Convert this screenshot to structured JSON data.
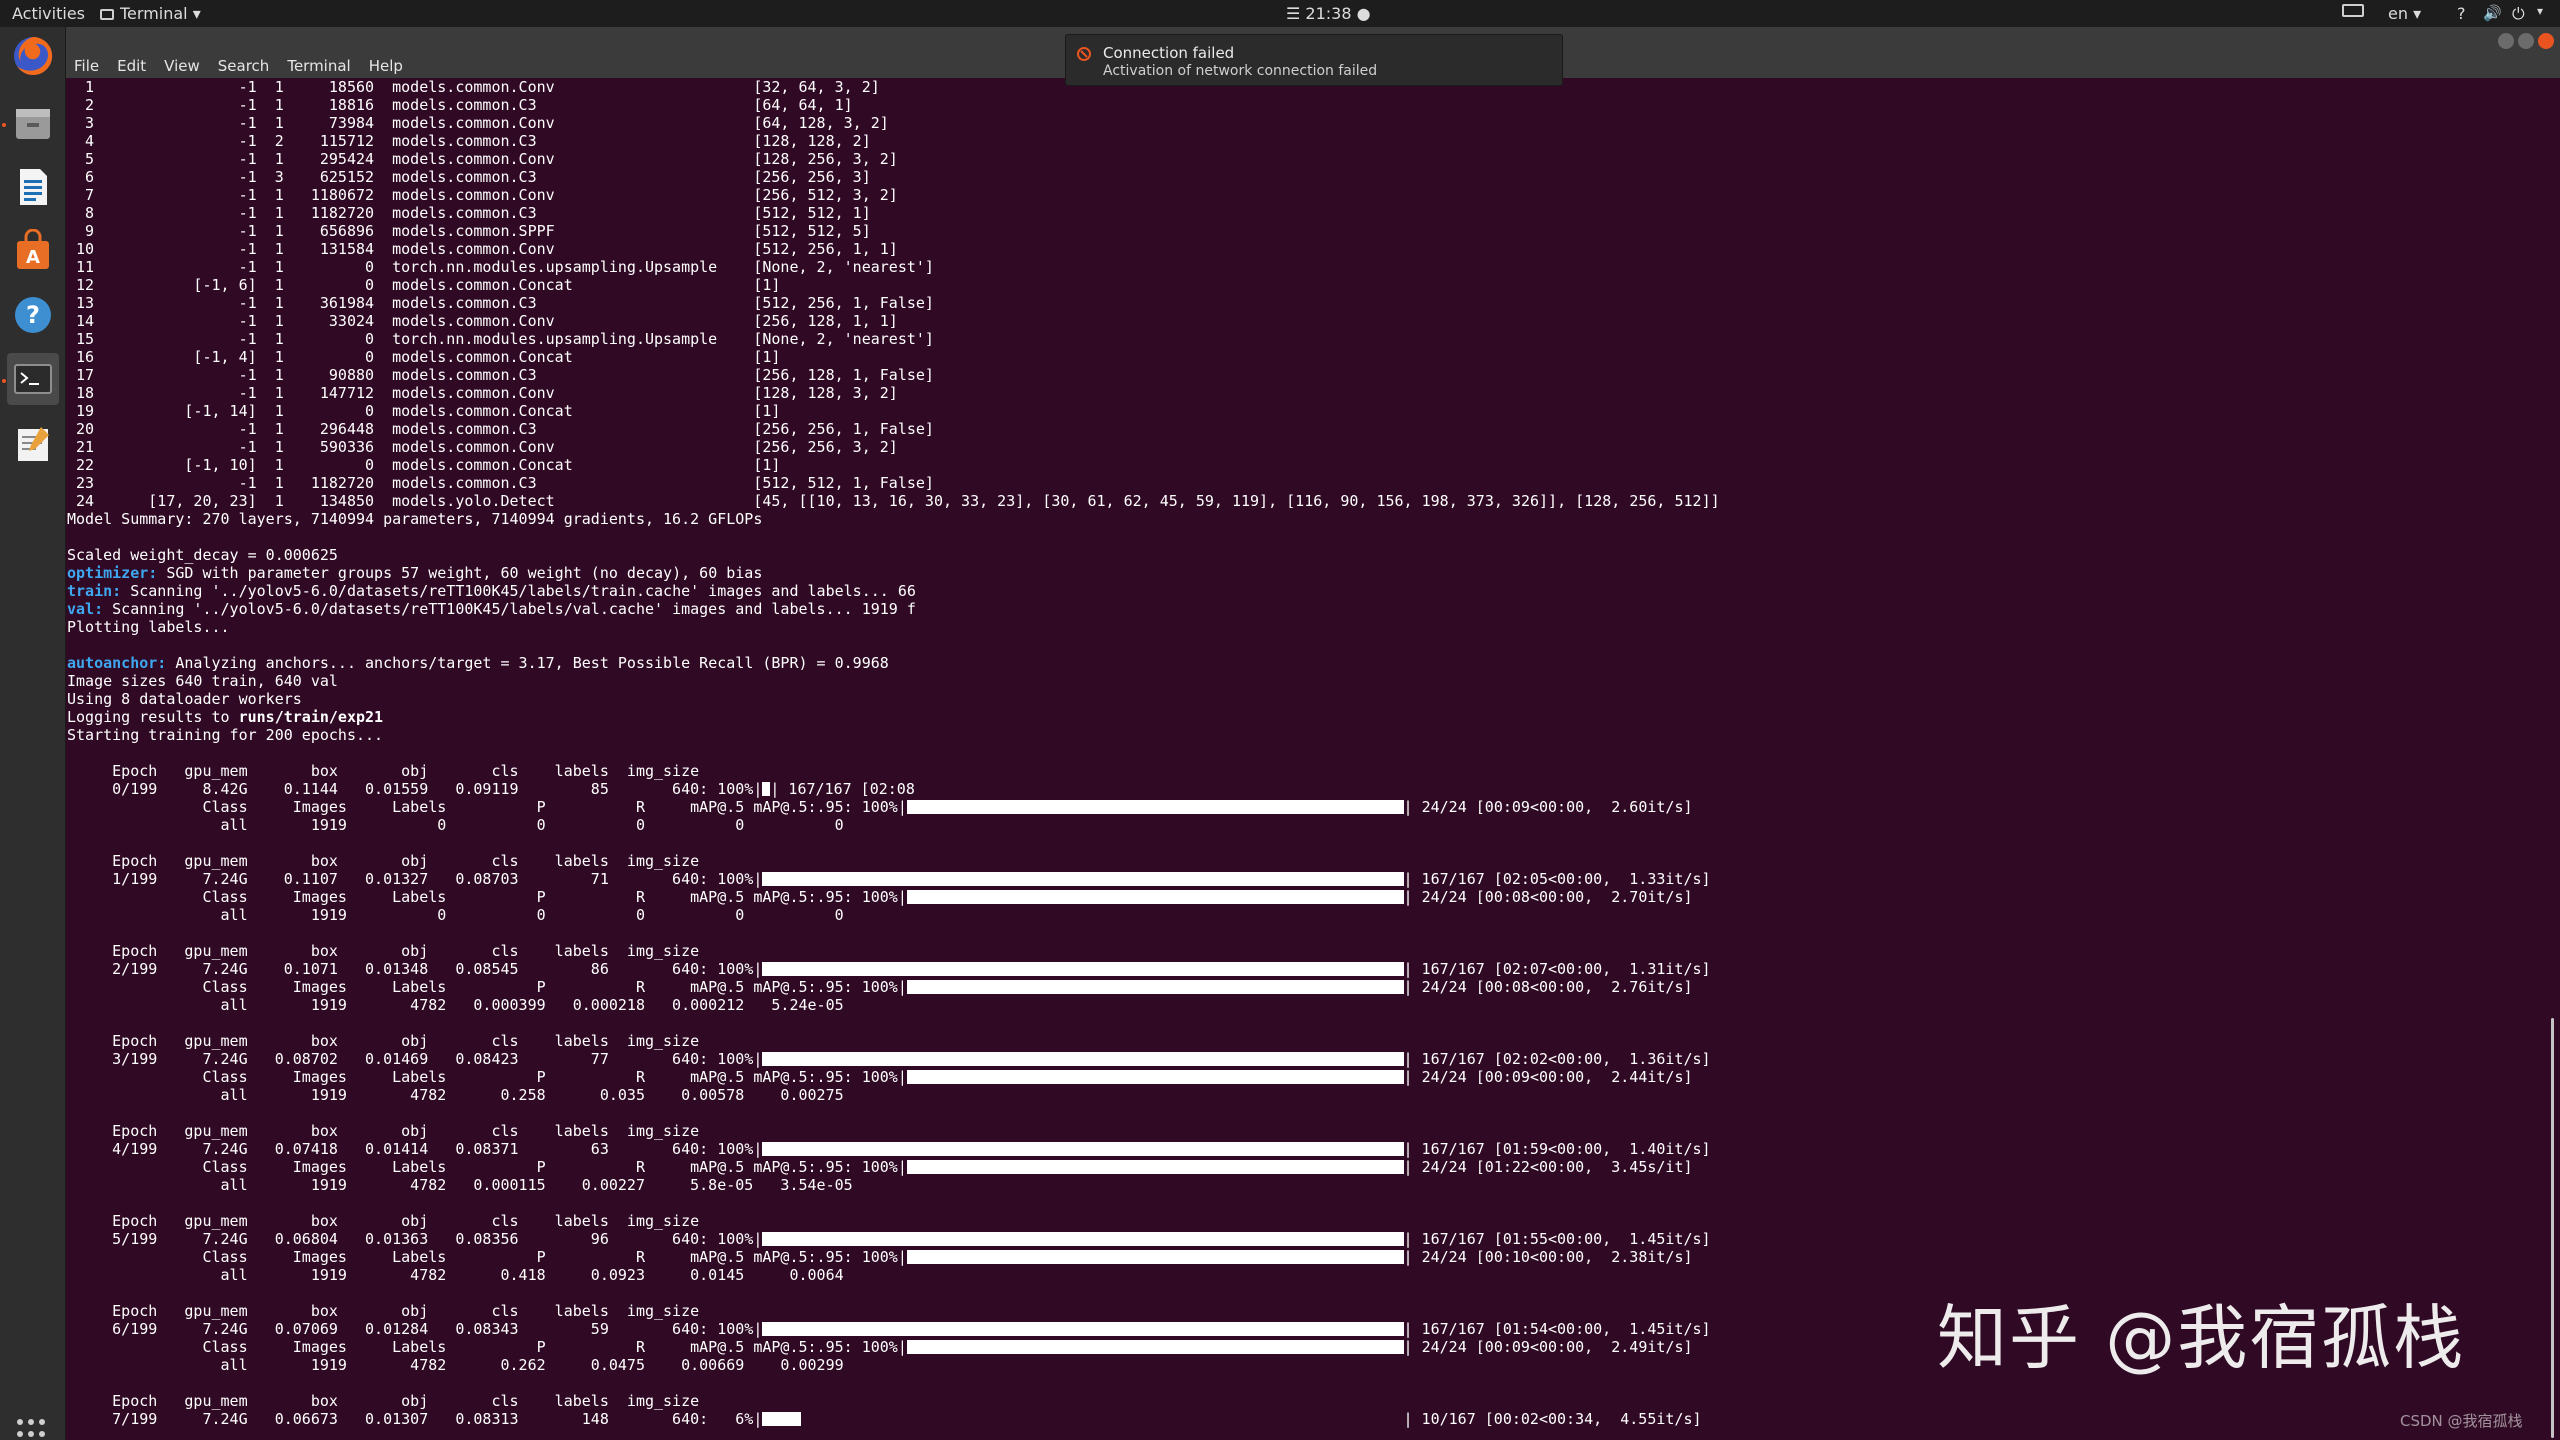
{
  "topbar": {
    "activities": "Activities",
    "app_name": "Terminal",
    "clock": "☰ 21:38 ●",
    "lang": "en ▾",
    "help": "?",
    "volume": "🔊",
    "power": "⏻",
    "caret": "▾"
  },
  "menu": [
    "File",
    "Edit",
    "View",
    "Search",
    "Terminal",
    "Help"
  ],
  "notification": {
    "title": "Connection failed",
    "body": "Activation of network connection failed"
  },
  "dock": [
    "firefox-icon",
    "files-icon",
    "libreoffice-writer-icon",
    "software-center-icon",
    "help-icon",
    "terminal-icon",
    "text-editor-icon"
  ],
  "terminal": {
    "layers": [
      "  1                -1  1     18560  models.common.Conv                      [32, 64, 3, 2]",
      "  2                -1  1     18816  models.common.C3                        [64, 64, 1]",
      "  3                -1  1     73984  models.common.Conv                      [64, 128, 3, 2]",
      "  4                -1  2    115712  models.common.C3                        [128, 128, 2]",
      "  5                -1  1    295424  models.common.Conv                      [128, 256, 3, 2]",
      "  6                -1  3    625152  models.common.C3                        [256, 256, 3]",
      "  7                -1  1   1180672  models.common.Conv                      [256, 512, 3, 2]",
      "  8                -1  1   1182720  models.common.C3                        [512, 512, 1]",
      "  9                -1  1    656896  models.common.SPPF                      [512, 512, 5]",
      " 10                -1  1    131584  models.common.Conv                      [512, 256, 1, 1]",
      " 11                -1  1         0  torch.nn.modules.upsampling.Upsample    [None, 2, 'nearest']",
      " 12           [-1, 6]  1         0  models.common.Concat                    [1]",
      " 13                -1  1    361984  models.common.C3                        [512, 256, 1, False]",
      " 14                -1  1     33024  models.common.Conv                      [256, 128, 1, 1]",
      " 15                -1  1         0  torch.nn.modules.upsampling.Upsample    [None, 2, 'nearest']",
      " 16           [-1, 4]  1         0  models.common.Concat                    [1]",
      " 17                -1  1     90880  models.common.C3                        [256, 128, 1, False]",
      " 18                -1  1    147712  models.common.Conv                      [128, 128, 3, 2]",
      " 19          [-1, 14]  1         0  models.common.Concat                    [1]",
      " 20                -1  1    296448  models.common.C3                        [256, 256, 1, False]",
      " 21                -1  1    590336  models.common.Conv                      [256, 256, 3, 2]",
      " 22          [-1, 10]  1         0  models.common.Concat                    [1]",
      " 23                -1  1   1182720  models.common.C3                        [512, 512, 1, False]",
      " 24      [17, 20, 23]  1    134850  models.yolo.Detect                      [45, [[10, 13, 16, 30, 33, 23], [30, 61, 62, 45, 59, 119], [116, 90, 156, 198, 373, 326]], [128, 256, 512]]"
    ],
    "summary": "Model Summary: 270 layers, 7140994 parameters, 7140994 gradients, 16.2 GFLOPs",
    "weight_decay": "Scaled weight_decay = 0.000625",
    "optimizer_key": "optimizer:",
    "optimizer_val": " SGD with parameter groups 57 weight, 60 weight (no decay), 60 bias",
    "train_key": "train:",
    "train_val": " Scanning '../yolov5-6.0/datasets/reTT100K45/labels/train.cache' images and labels... 66",
    "val_key": "val:",
    "val_val": " Scanning '../yolov5-6.0/datasets/reTT100K45/labels/val.cache' images and labels... 1919 f",
    "plotting": "Plotting labels...",
    "autoanchor_key": "autoanchor:",
    "autoanchor_val": " Analyzing anchors... anchors/target = 3.17, Best Possible Recall (BPR) = 0.9968",
    "image_sizes": "Image sizes 640 train, 640 val",
    "workers": "Using 8 dataloader workers",
    "logging_prefix": "Logging results to ",
    "logging_path": "runs/train/exp21",
    "starting": "Starting training for 200 epochs...",
    "epoch_header": "     Epoch   gpu_mem       box       obj       cls    labels  img_size",
    "class_header": "               Class     Images     Labels          P          R     mAP@.5 mAP@.5:.95: 100%|",
    "epochs": [
      {
        "row": "     0/199     8.42G    0.1144   0.01559   0.09119        85       640: 100%|",
        "tail": "| 167/167 [02:08",
        "val_tail": "| 24/24 [00:09<00:00,  2.60it/s]",
        "all": "                 all       1919          0          0          0          0          0",
        "progress": 0.01
      },
      {
        "row": "     1/199     7.24G    0.1107   0.01327   0.08703        71       640: 100%|",
        "tail": "| 167/167 [02:05<00:00,  1.33it/s]",
        "val_tail": "| 24/24 [00:08<00:00,  2.70it/s]",
        "all": "                 all       1919          0          0          0          0          0",
        "progress": 1.0
      },
      {
        "row": "     2/199     7.24G    0.1071   0.01348   0.08545        86       640: 100%|",
        "tail": "| 167/167 [02:07<00:00,  1.31it/s]",
        "val_tail": "| 24/24 [00:08<00:00,  2.76it/s]",
        "all": "                 all       1919       4782   0.000399   0.000218   0.000212   5.24e-05",
        "progress": 1.0
      },
      {
        "row": "     3/199     7.24G   0.08702   0.01469   0.08423        77       640: 100%|",
        "tail": "| 167/167 [02:02<00:00,  1.36it/s]",
        "val_tail": "| 24/24 [00:09<00:00,  2.44it/s]",
        "all": "                 all       1919       4782      0.258      0.035    0.00578    0.00275",
        "progress": 1.0
      },
      {
        "row": "     4/199     7.24G   0.07418   0.01414   0.08371        63       640: 100%|",
        "tail": "| 167/167 [01:59<00:00,  1.40it/s]",
        "val_tail": "| 24/24 [01:22<00:00,  3.45s/it]",
        "all": "                 all       1919       4782   0.000115    0.00227     5.8e-05   3.54e-05",
        "progress": 1.0
      },
      {
        "row": "     5/199     7.24G   0.06804   0.01363   0.08356        96       640: 100%|",
        "tail": "| 167/167 [01:55<00:00,  1.45it/s]",
        "val_tail": "| 24/24 [00:10<00:00,  2.38it/s]",
        "all": "                 all       1919       4782      0.418     0.0923     0.0145     0.0064",
        "progress": 1.0
      },
      {
        "row": "     6/199     7.24G   0.07069   0.01284   0.08343        59       640: 100%|",
        "tail": "| 167/167 [01:54<00:00,  1.45it/s]",
        "val_tail": "| 24/24 [00:09<00:00,  2.49it/s]",
        "all": "                 all       1919       4782      0.262     0.0475    0.00669    0.00299",
        "progress": 1.0
      }
    ],
    "last_epoch_row": "     7/199     7.24G   0.06673   0.01307   0.08313       148       640:   6%|",
    "last_epoch_tail": "| 10/167 [00:02<00:34,  4.55it/s]",
    "last_epoch_progress": 0.06
  },
  "watermark": "知乎 @我宿孤栈",
  "watermark_small": "CSDN @我宿孤栈"
}
